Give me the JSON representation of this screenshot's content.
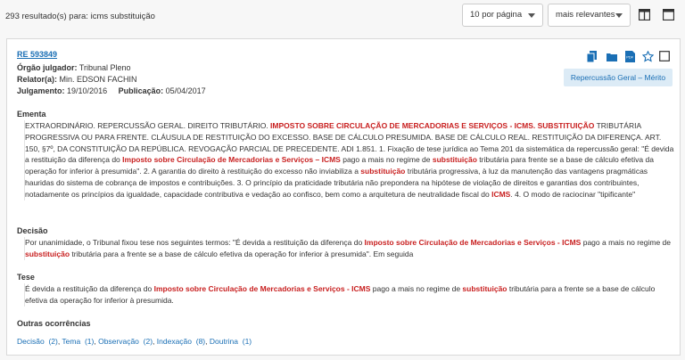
{
  "topbar": {
    "results_text": "293 resultado(s) para: icms substituição",
    "per_page": "10 por página",
    "order": "mais relevantes"
  },
  "result": {
    "id": "RE 593849",
    "orgao_label": "Órgão julgador:",
    "orgao_value": "Tribunal Pleno",
    "relator_label": "Relator(a):",
    "relator_value": "Min. EDSON FACHIN",
    "julgamento_label": "Julgamento:",
    "julgamento_value": "19/10/2016",
    "publicacao_label": "Publicação:",
    "publicacao_value": "05/04/2017",
    "tag": "Repercussão Geral – Mérito",
    "ementa_title": "Ementa",
    "ementa": [
      {
        "t": "EXTRAORDINÁRIO. REPERCUSSÃO GERAL. DIREITO TRIBUTÁRIO. "
      },
      {
        "t": "IMPOSTO SOBRE CIRCULAÇÃO DE MERCADORIAS E SERVIÇOS - ICMS. SUBSTITUIÇÃO",
        "h": true
      },
      {
        "t": " TRIBUTÁRIA PROGRESSIVA OU PARA FRENTE. CLÁUSULA DE RESTITUIÇÃO DO EXCESSO. BASE DE CÁLCULO PRESUMIDA. BASE DE CÁLCULO REAL. RESTITUIÇÃO DA DIFERENÇA. ART. 150, §7º, DA CONSTITUIÇÃO DA REPÚBLICA. REVOGAÇÃO PARCIAL DE PRECEDENTE. ADI 1.851. 1. Fixação de tese jurídica ao Tema 201 da sistemática da repercussão geral: \"É devida a restituição da diferença do "
      },
      {
        "t": "Imposto sobre Circulação de Mercadorias e Serviços – ICMS",
        "h": true
      },
      {
        "t": " pago a mais no regime de "
      },
      {
        "t": "substituição",
        "h": true
      },
      {
        "t": " tributária para frente se a base de cálculo efetiva da operação for inferior à presumida\". 2. A garantia do direito à restituição do excesso não inviabiliza a "
      },
      {
        "t": "substituição",
        "h": true
      },
      {
        "t": " tributária progressiva, à luz da manutenção das vantagens pragmáticas hauridas do sistema de cobrança de impostos e contribuições. 3. O princípio da praticidade tributária não prepondera na hipótese de violação de direitos e garantias dos contribuintes, notadamente os princípios da igualdade, capacidade contributiva e vedação ao confisco, bem como a arquitetura de neutralidade fiscal do "
      },
      {
        "t": "ICMS",
        "h": true
      },
      {
        "t": ". 4. O modo de raciocinar \"tipificante\""
      }
    ],
    "decisao_title": "Decisão",
    "decisao": [
      {
        "t": "Por unanimidade, o Tribunal fixou tese nos seguintes termos: \"É devida a restituição da diferença do "
      },
      {
        "t": "Imposto sobre Circulação de Mercadorias e Serviços - ICMS",
        "h": true
      },
      {
        "t": " pago a mais no regime de "
      },
      {
        "t": "substituição",
        "h": true
      },
      {
        "t": " tributária para a frente se a base de cálculo efetiva da operação for inferior à presumida\". Em seguida"
      }
    ],
    "tese_title": "Tese",
    "tese": [
      {
        "t": "É devida a restituição da diferença do "
      },
      {
        "t": "Imposto sobre Circulação de Mercadorias e Serviços - ICMS",
        "h": true
      },
      {
        "t": " pago a mais no regime de "
      },
      {
        "t": "substituição",
        "h": true
      },
      {
        "t": " tributária para a frente se a base de cálculo efetiva da operação for inferior à presumida."
      }
    ],
    "outras_title": "Outras ocorrências",
    "ocorrencias": [
      {
        "label": "Decisão",
        "count": "(2)"
      },
      {
        "label": "Tema",
        "count": "(1)"
      },
      {
        "label": "Observação",
        "count": "(2)"
      },
      {
        "label": "Indexação",
        "count": "(8)"
      },
      {
        "label": "Doutrina",
        "count": "(1)"
      }
    ]
  },
  "colors": {
    "accent": "#1a6fb5",
    "highlight": "#c81f1f",
    "tag_bg": "#dcebf6"
  },
  "icons": [
    "grid-view-icon",
    "list-view-icon",
    "copy-document-icon",
    "folder-icon",
    "pdf-icon",
    "star-icon",
    "select-checkbox"
  ]
}
